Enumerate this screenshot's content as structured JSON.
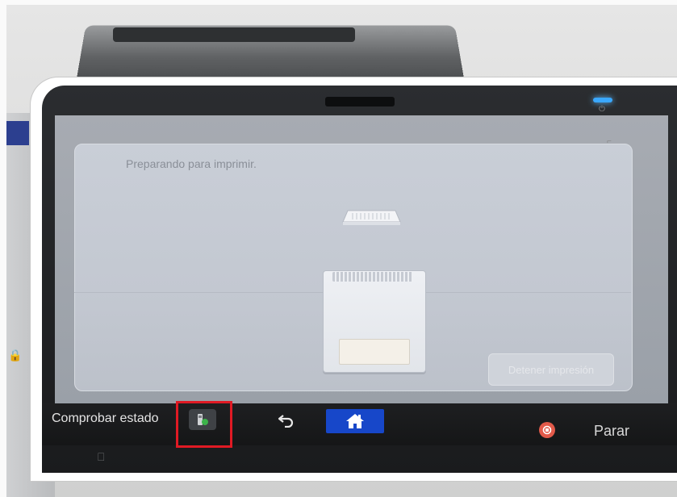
{
  "screen": {
    "status_message": "Preparando para imprimir.",
    "stop_print_button": "Detener impresión"
  },
  "bottom_bar": {
    "check_status_label": "Comprobar estado",
    "stop_label": "Parar",
    "icons": {
      "status": "status-icon",
      "back": "back-arrow-icon",
      "home": "home-icon",
      "stop": "stop-icon"
    }
  },
  "colors": {
    "home_button": "#1747c9",
    "highlight": "#e01a24",
    "led": "#3aa8ff",
    "stop_icon": "#e25a4a"
  }
}
